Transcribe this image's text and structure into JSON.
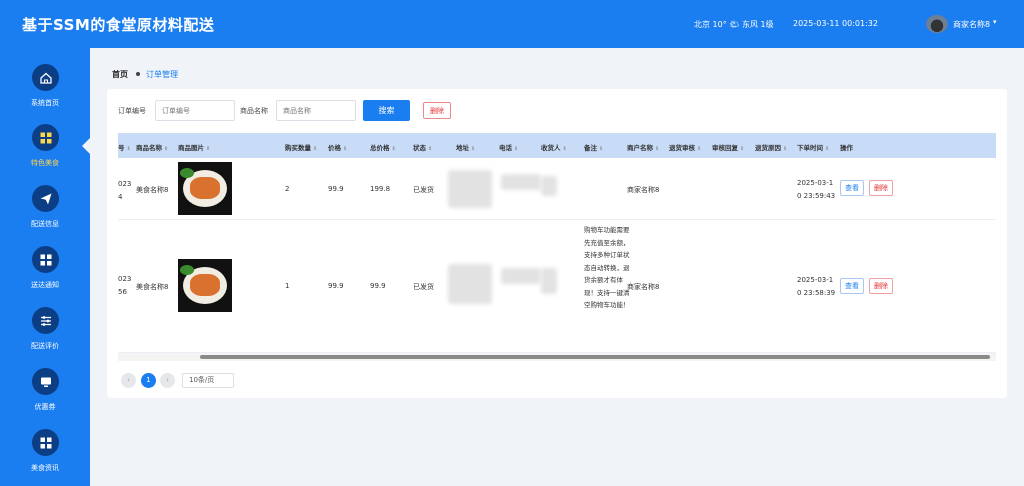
{
  "header": {
    "title": "基于SSM的食堂原材料配送",
    "weather": "北京  10°  🌤  东风  1级",
    "datetime": "2025-03-11 00:01:32",
    "user_name": "商家名称8",
    "user_caret": "▾",
    "brand_color": "#1a7df0"
  },
  "sidebar": {
    "items": [
      {
        "label": "系统首页",
        "icon": "home-icon"
      },
      {
        "label": "特色美食",
        "icon": "grid-icon",
        "active": true
      },
      {
        "label": "配送信息",
        "icon": "send-icon"
      },
      {
        "label": "送达通知",
        "icon": "grid-icon"
      },
      {
        "label": "配送评价",
        "icon": "sliders-icon"
      },
      {
        "label": "优惠券",
        "icon": "monitor-icon"
      },
      {
        "label": "美食资讯",
        "icon": "grid-icon"
      }
    ]
  },
  "breadcrumb": {
    "home": "首页",
    "current": "订单管理"
  },
  "search": {
    "order_label": "订单编号",
    "order_placeholder": "订单编号",
    "goods_label": "商品名称",
    "goods_placeholder": "商品名称",
    "search_button": "搜索",
    "delete_button": "删除"
  },
  "table": {
    "columns": [
      "号",
      "商品名称",
      "商品图片",
      "购买数量",
      "价格",
      "总价格",
      "状态",
      "地址",
      "电话",
      "收货人",
      "备注",
      "商户名称",
      "退货审核",
      "审核回复",
      "退货原因",
      "下单时间",
      "操作"
    ],
    "sort_glyph": "⇕",
    "rows": [
      {
        "order_no": "023\n4",
        "order_no_a": "023",
        "order_no_b": "4",
        "goods_name": "美食名称8",
        "quantity": "2",
        "price": "99.9",
        "total": "199.8",
        "status": "已发货",
        "note": "",
        "merchant": "商家名称8",
        "time_a": "2025-03-1",
        "time_b": "0 23:59:43",
        "view": "查看",
        "delete": "删除"
      },
      {
        "order_no_a": "023",
        "order_no_b": "56",
        "goods_name": "美食名称8",
        "quantity": "1",
        "price": "99.9",
        "total": "99.9",
        "status": "已发货",
        "note": "购物车功能需要先充值至余额，支持多种订单状态自动转换，退货余额才有体现！支持一键清空购物车功能！",
        "merchant": "商家名称8",
        "time_a": "2025-03-1",
        "time_b": "0 23:58:39",
        "view": "查看",
        "delete": "删除"
      }
    ]
  },
  "pagination": {
    "prev": "‹",
    "current_page": "1",
    "next": "›",
    "page_size": "10条/页"
  }
}
